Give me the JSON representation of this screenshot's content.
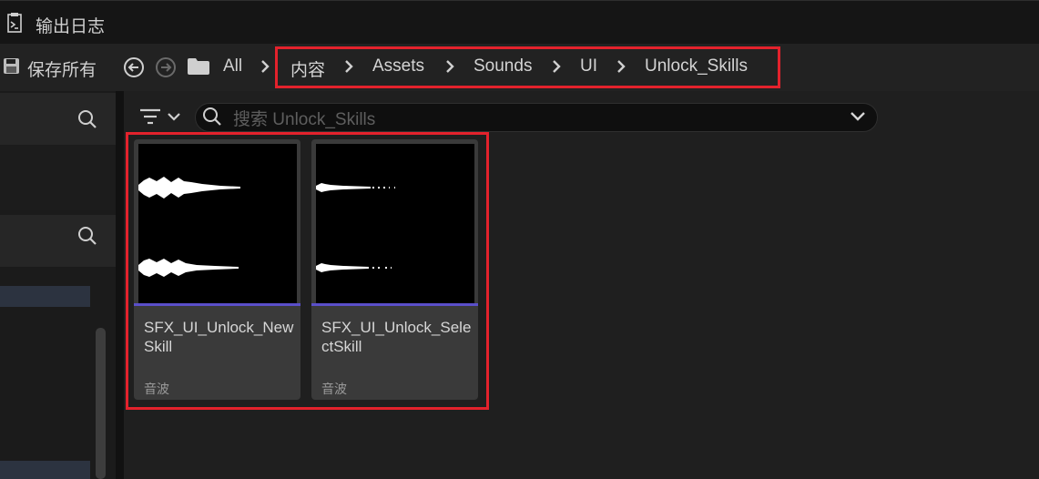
{
  "topbar": {
    "title": "输出日志"
  },
  "toolbar": {
    "save_all": "保存所有",
    "all_label": "All",
    "breadcrumb": [
      "内容",
      "Assets",
      "Sounds",
      "UI",
      "Unlock_Skills"
    ]
  },
  "search": {
    "placeholder": "搜索 Unlock_Skills"
  },
  "assets": [
    {
      "name": "SFX_UI_Unlock_NewSkill",
      "type": "音波"
    },
    {
      "name": "SFX_UI_Unlock_SelectSkill",
      "type": "音波"
    }
  ],
  "colors": {
    "highlight": "#e3222c",
    "asset_type_bar": "#5a4fc9"
  }
}
